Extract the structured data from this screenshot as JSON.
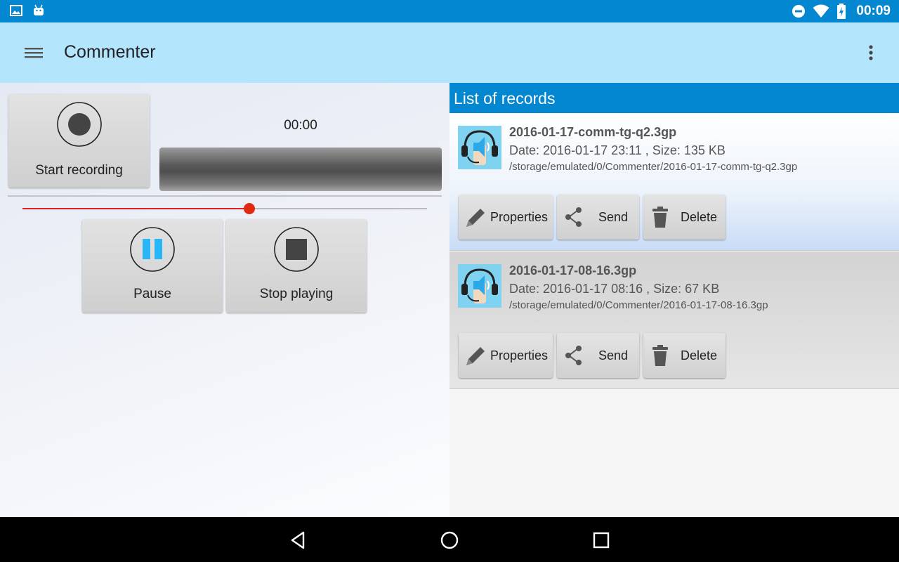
{
  "status_bar": {
    "time": "00:09",
    "icons": [
      "image-icon",
      "android-icon",
      "do-not-disturb-icon",
      "wifi-icon",
      "battery-charging-icon"
    ]
  },
  "app_bar": {
    "title": "Commenter",
    "icons": [
      "hamburger-menu-icon",
      "overflow-menu-icon"
    ]
  },
  "recorder": {
    "start_recording_label": "Start recording",
    "timer": "00:00",
    "pause_label": "Pause",
    "stop_playing_label": "Stop playing",
    "seek_progress_percent": 56
  },
  "records": {
    "header": "List of records",
    "items": [
      {
        "name": "2016-01-17-comm-tg-q2.3gp",
        "info": "Date: 2016-01-17 23:11 , Size: 135 KB",
        "path": "/storage/emulated/0/Commenter/2016-01-17-comm-tg-q2.3gp",
        "properties_label": "Properties",
        "send_label": "Send",
        "delete_label": "Delete"
      },
      {
        "name": "2016-01-17-08-16.3gp",
        "info": "Date: 2016-01-17 08:16 , Size: 67 KB",
        "path": "/storage/emulated/0/Commenter/2016-01-17-08-16.3gp",
        "properties_label": "Properties",
        "send_label": "Send",
        "delete_label": "Delete"
      }
    ]
  },
  "nav_bar": {
    "icons": [
      "back-icon",
      "home-icon",
      "recents-icon"
    ]
  },
  "colors": {
    "status_bar": "#0387d0",
    "app_bar": "#b3e5fc",
    "seek_fill": "#e02020",
    "pause_icon": "#29b6f6"
  }
}
